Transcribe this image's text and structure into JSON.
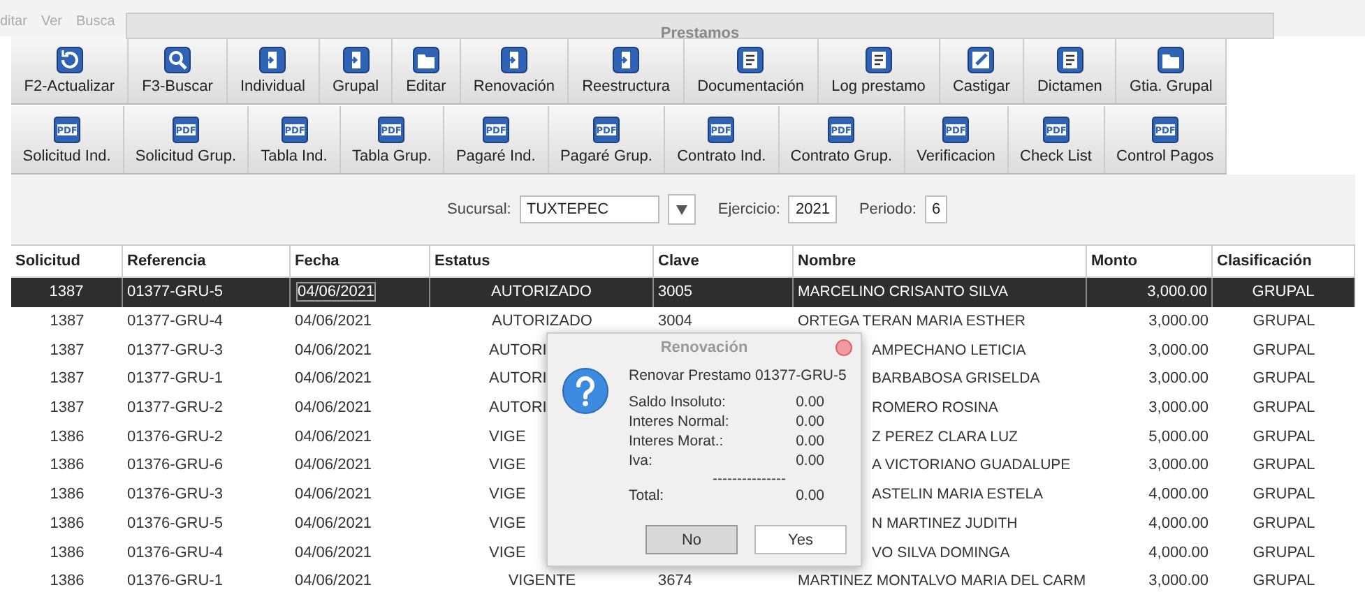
{
  "back_window": {
    "menu": [
      "ditar",
      "Ver",
      "Busca"
    ]
  },
  "window": {
    "title": "Prestamos"
  },
  "toolbar_1": [
    {
      "label": "F2-Actualizar",
      "kind": "refresh"
    },
    {
      "label": "F3-Buscar",
      "kind": "search"
    },
    {
      "label": "Individual",
      "kind": "doc"
    },
    {
      "label": "Grupal",
      "kind": "doc"
    },
    {
      "label": "Editar",
      "kind": "folder"
    },
    {
      "label": "Renovación",
      "kind": "doc"
    },
    {
      "label": "Reestructura",
      "kind": "doc"
    },
    {
      "label": "Documentación",
      "kind": "list"
    },
    {
      "label": "Log prestamo",
      "kind": "list"
    },
    {
      "label": "Castigar",
      "kind": "edit"
    },
    {
      "label": "Dictamen",
      "kind": "list"
    },
    {
      "label": "Gtia. Grupal",
      "kind": "folder"
    }
  ],
  "toolbar_2": [
    {
      "label": "Solicitud Ind.",
      "kind": "pdf",
      "icon_text": "PDF"
    },
    {
      "label": "Solicitud Grup.",
      "kind": "pdf",
      "icon_text": "PDF"
    },
    {
      "label": "Tabla Ind.",
      "kind": "pdf",
      "icon_text": "PDF"
    },
    {
      "label": "Tabla Grup.",
      "kind": "pdf",
      "icon_text": "PDF"
    },
    {
      "label": "Pagaré Ind.",
      "kind": "pdf",
      "icon_text": "PDF"
    },
    {
      "label": "Pagaré Grup.",
      "kind": "pdf",
      "icon_text": "PDF"
    },
    {
      "label": "Contrato Ind.",
      "kind": "pdf",
      "icon_text": "PDF"
    },
    {
      "label": "Contrato Grup.",
      "kind": "pdf",
      "icon_text": "PDF"
    },
    {
      "label": "Verificacion",
      "kind": "pdf",
      "icon_text": "PDF"
    },
    {
      "label": "Check List",
      "kind": "pdf",
      "icon_text": "PDF"
    },
    {
      "label": "Control Pagos",
      "kind": "pdf",
      "icon_text": "PDF"
    }
  ],
  "filters": {
    "sucursal_label": "Sucursal:",
    "sucursal": "TUXTEPEC",
    "ejercicio_label": "Ejercicio:",
    "ejercicio": "2021",
    "periodo_label": "Periodo:",
    "periodo": "6"
  },
  "table": {
    "columns": [
      "Solicitud",
      "Referencia",
      "Fecha",
      "Estatus",
      "Clave",
      "Nombre",
      "Monto",
      "Clasificación"
    ],
    "rows": [
      {
        "solicitud": "1387",
        "referencia": "01377-GRU-5",
        "fecha": "04/06/2021",
        "estatus": "AUTORIZADO",
        "clave": "3005",
        "nombre": "MARCELINO CRISANTO SILVA",
        "monto": "3,000.00",
        "clasificacion": "GRUPAL",
        "selected": true,
        "covered": false
      },
      {
        "solicitud": "1387",
        "referencia": "01377-GRU-4",
        "fecha": "04/06/2021",
        "estatus": "AUTORIZADO",
        "clave": "3004",
        "nombre": "ORTEGA TERAN MARIA ESTHER",
        "monto": "3,000.00",
        "clasificacion": "GRUPAL",
        "selected": false,
        "covered": false
      },
      {
        "solicitud": "1387",
        "referencia": "01377-GRU-3",
        "fecha": "04/06/2021",
        "estatus": "AUTORI",
        "nombre": "AMPECHANO LETICIA",
        "monto": "3,000.00",
        "clasificacion": "GRUPAL",
        "selected": false,
        "covered": true
      },
      {
        "solicitud": "1387",
        "referencia": "01377-GRU-1",
        "fecha": "04/06/2021",
        "estatus": "AUTORI",
        "nombre": "BARBABOSA GRISELDA",
        "monto": "3,000.00",
        "clasificacion": "GRUPAL",
        "selected": false,
        "covered": true
      },
      {
        "solicitud": "1387",
        "referencia": "01377-GRU-2",
        "fecha": "04/06/2021",
        "estatus": "AUTORI",
        "nombre": "ROMERO ROSINA",
        "monto": "3,000.00",
        "clasificacion": "GRUPAL",
        "selected": false,
        "covered": true
      },
      {
        "solicitud": "1386",
        "referencia": "01376-GRU-2",
        "fecha": "04/06/2021",
        "estatus": "VIGE",
        "nombre": "Z PEREZ CLARA LUZ",
        "monto": "5,000.00",
        "clasificacion": "GRUPAL",
        "selected": false,
        "covered": true
      },
      {
        "solicitud": "1386",
        "referencia": "01376-GRU-6",
        "fecha": "04/06/2021",
        "estatus": "VIGE",
        "nombre": "A VICTORIANO GUADALUPE",
        "monto": "3,000.00",
        "clasificacion": "GRUPAL",
        "selected": false,
        "covered": true
      },
      {
        "solicitud": "1386",
        "referencia": "01376-GRU-3",
        "fecha": "04/06/2021",
        "estatus": "VIGE",
        "nombre": "ASTELIN MARIA ESTELA",
        "monto": "4,000.00",
        "clasificacion": "GRUPAL",
        "selected": false,
        "covered": true
      },
      {
        "solicitud": "1386",
        "referencia": "01376-GRU-5",
        "fecha": "04/06/2021",
        "estatus": "VIGE",
        "nombre": "N MARTINEZ JUDITH",
        "monto": "4,000.00",
        "clasificacion": "GRUPAL",
        "selected": false,
        "covered": true
      },
      {
        "solicitud": "1386",
        "referencia": "01376-GRU-4",
        "fecha": "04/06/2021",
        "estatus": "VIGE",
        "nombre": "VO SILVA DOMINGA",
        "monto": "4,000.00",
        "clasificacion": "GRUPAL",
        "selected": false,
        "covered": true
      },
      {
        "solicitud": "1386",
        "referencia": "01376-GRU-1",
        "fecha": "04/06/2021",
        "estatus": "VIGENTE",
        "clave": "3674",
        "nombre": "MARTINEZ MONTALVO MARIA DEL CARM",
        "monto": "3,000.00",
        "clasificacion": "GRUPAL",
        "selected": false,
        "covered": false
      }
    ]
  },
  "dialog": {
    "title": "Renovación",
    "message": "Renovar Prestamo 01377-GRU-5",
    "lines": [
      {
        "label": "Saldo Insoluto:",
        "value": "0.00"
      },
      {
        "label": "Interes Normal:",
        "value": "0.00"
      },
      {
        "label": "Interes Morat.:",
        "value": "0.00"
      },
      {
        "label": "Iva:",
        "value": "0.00"
      }
    ],
    "separator": "---------------",
    "total_label": "Total:",
    "total": "0.00",
    "buttons": [
      {
        "label": "No",
        "selected": true
      },
      {
        "label": "Yes",
        "selected": false
      }
    ]
  }
}
